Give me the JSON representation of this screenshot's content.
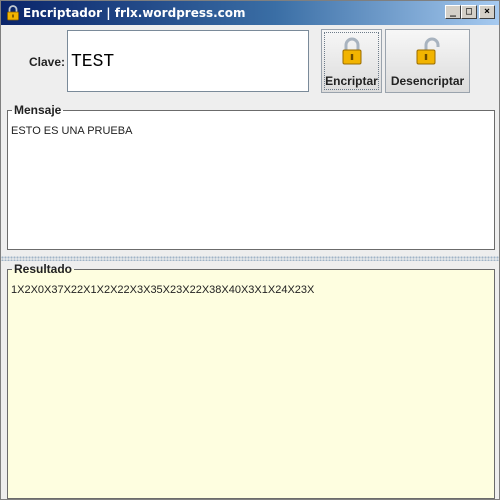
{
  "window": {
    "title": "Encriptador | frlx.wordpress.com",
    "minimize_glyph": "_",
    "maximize_glyph": "□",
    "close_glyph": "×"
  },
  "clave": {
    "label": "Clave:",
    "value": "TEST"
  },
  "buttons": {
    "encrypt_label": "Encriptar",
    "decrypt_label": "Desencriptar",
    "encrypt_icon": "lock-closed-icon",
    "decrypt_icon": "lock-open-icon"
  },
  "mensaje": {
    "title": "Mensaje",
    "text": "ESTO ES UNA PRUEBA"
  },
  "resultado": {
    "title": "Resultado",
    "text": "1X2X0X37X22X1X2X22X3X35X23X22X38X40X3X1X24X23X"
  },
  "colors": {
    "result_background": "#fefee0",
    "title_bar_start": "#0a246a",
    "title_bar_end": "#a6caf0",
    "lock_gold": "#f2b400"
  }
}
